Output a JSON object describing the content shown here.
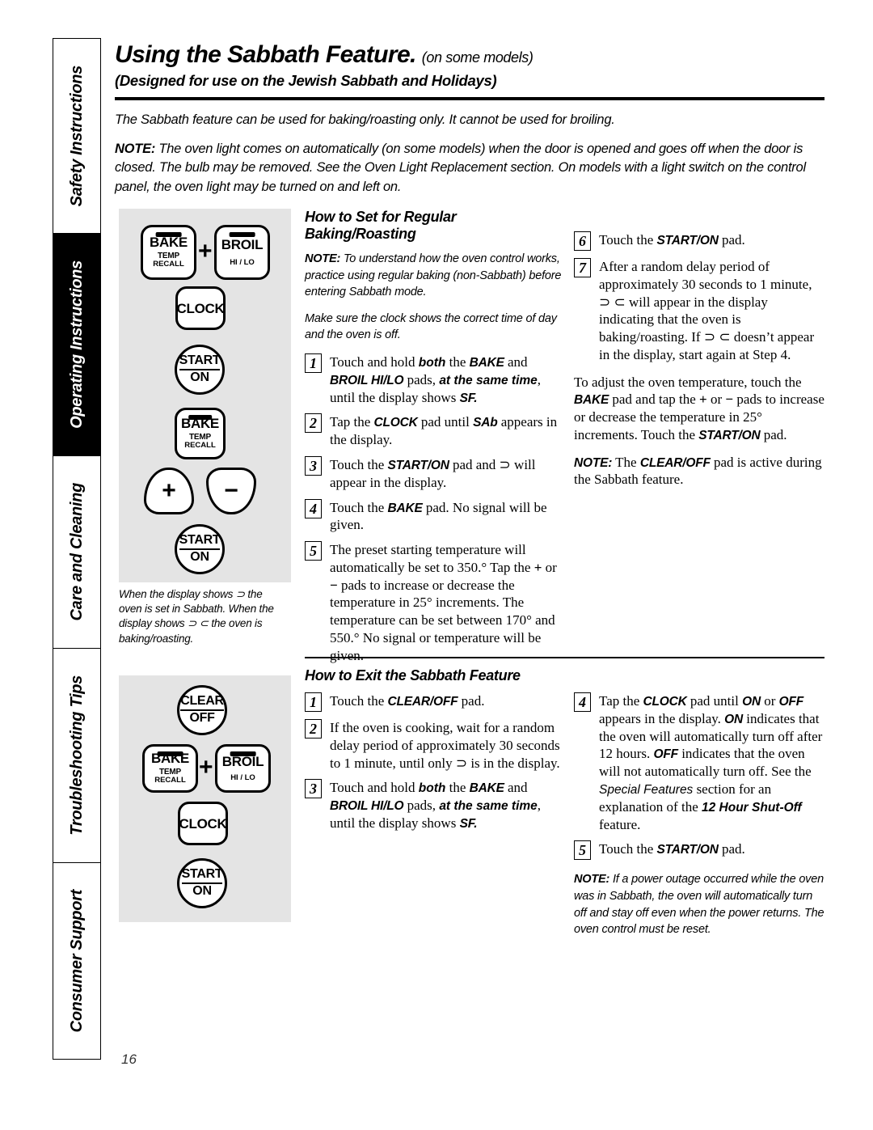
{
  "sidebar": {
    "tabs": [
      {
        "label": "Safety Instructions",
        "active": false
      },
      {
        "label": "Operating Instructions",
        "active": true
      },
      {
        "label": "Care and Cleaning",
        "active": false
      },
      {
        "label": "Troubleshooting Tips",
        "active": false
      },
      {
        "label": "Consumer Support",
        "active": false
      }
    ]
  },
  "header": {
    "title": "Using the Sabbath Feature.",
    "title_suffix": "(on some models)",
    "subtitle": "(Designed for use on the Jewish Sabbath and Holidays)",
    "intro": "The Sabbath feature can be used for baking/roasting only. It cannot be used for broiling.",
    "note_label": "NOTE:",
    "note_text": " The oven light comes on automatically (on some models) when the door is opened and goes off when the door is closed. The bulb may be removed. See the Oven Light Replacement section. On models with a light switch on the control panel, the oven light may be turned on and left on."
  },
  "set_section": {
    "heading": "How to Set for Regular Baking/Roasting",
    "note_label": "NOTE:",
    "note_text": " To understand how the oven control works, practice using regular baking (non-Sabbath) before entering Sabbath mode.",
    "note2": "Make sure the clock shows the correct time of day and the oven is off.",
    "steps": [
      {
        "num": "1",
        "text_html": "Touch and hold <i class=\"emb\">both</i> the <b class=\"pad\">BAKE</b> and <b class=\"pad\">BROIL HI/LO</b> pads, <i class=\"emb\">at the same time</i>, until the display shows <b class=\"pad\">SF.</b>"
      },
      {
        "num": "2",
        "text_html": "Tap the <b class=\"pad\">CLOCK</b> pad until <b class=\"pad\">SAb</b> appears in the display."
      },
      {
        "num": "3",
        "text_html": "Touch the <b class=\"pad\">START/ON</b> pad and &#8835; will appear in the display."
      },
      {
        "num": "4",
        "text_html": "Touch the <b class=\"pad\">BAKE</b> pad. No signal will be given."
      },
      {
        "num": "5",
        "text_html": "The preset starting temperature will automatically be set to 350.&deg; Tap the <b>+</b> or <b>&minus;</b> pads to increase or decrease the temperature in 25&deg; increments. The temperature can be set between 170&deg; and 550.&deg; No signal or temperature will be given."
      },
      {
        "num": "6",
        "text_html": "Touch the <b class=\"pad\">START/ON</b> pad."
      },
      {
        "num": "7",
        "text_html": "After a random delay period of approximately 30 seconds to 1 minute, &#8835; &#8834; will appear in the display indicating that the oven is baking/roasting. If &#8835; &#8834; doesn&rsquo;t appear in the display, start again at Step 4."
      }
    ],
    "adjust_html": "To adjust the oven temperature, touch the <b class=\"pad\">BAKE</b> pad and tap the <b>+</b> or <b>&minus;</b> pads to increase or decrease the temperature in 25&deg; increments. Touch the <b class=\"pad\">START/ON</b> pad.",
    "note3_html": "<b class=\"pad\">NOTE:</b> The <b class=\"pad\">CLEAR/OFF</b> pad is active during the Sabbath feature.",
    "caption": "When the display shows ⊃ the oven is set in Sabbath. When the display shows ⊃ ⊂ the oven is baking/roasting."
  },
  "exit_section": {
    "heading": "How to Exit the Sabbath Feature",
    "steps": [
      {
        "num": "1",
        "text_html": "Touch the <b class=\"pad\">CLEAR/OFF</b> pad."
      },
      {
        "num": "2",
        "text_html": "If the oven is cooking, wait for a random delay period of approximately 30 seconds to 1 minute, until only &#8835; is in the display."
      },
      {
        "num": "3",
        "text_html": "Touch and hold <i class=\"emb\">both</i> the <b class=\"pad\">BAKE</b> and <b class=\"pad\">BROIL HI/LO</b> pads, <i class=\"emb\">at the same time</i>, until the display shows <b class=\"pad\">SF.</b>"
      },
      {
        "num": "4",
        "text_html": "Tap the <b class=\"pad\">CLOCK</b> pad until <b class=\"pad\">ON</b> or <b class=\"pad\">OFF</b> appears in the display. <b class=\"pad\">ON</b> indicates that the oven will automatically turn off after 12 hours. <b class=\"pad\">OFF</b> indicates that the oven will not automatically turn off. See the <i class=\"em\">Special Features</i> section for an explanation of the <i class=\"emb\">12 Hour Shut-Off</i> feature."
      },
      {
        "num": "5",
        "text_html": "Touch the <b class=\"pad\">START/ON</b> pad."
      }
    ],
    "note_label": "NOTE:",
    "note_text": " If a power outage occurred while the oven was in Sabbath, the oven will automatically turn off and stay off even when the power returns. The oven control must be reset."
  },
  "diagram_top": {
    "buttons": [
      {
        "name": "bake",
        "main": "BAKE",
        "sub": "TEMP",
        "sub2": "RECALL"
      },
      {
        "name": "broil",
        "main": "BROIL",
        "sub2": "HI / LO"
      },
      {
        "name": "clock",
        "main": "CLOCK"
      },
      {
        "name": "start-on-1",
        "top": "START",
        "bot": "ON"
      },
      {
        "name": "bake-2",
        "main": "BAKE",
        "sub": "TEMP",
        "sub2": "RECALL"
      },
      {
        "name": "plus-pad",
        "glyph": "+"
      },
      {
        "name": "minus-pad",
        "glyph": "−"
      },
      {
        "name": "start-on-2",
        "top": "START",
        "bot": "ON"
      }
    ],
    "plus_connector": "+"
  },
  "diagram_bottom": {
    "buttons": [
      {
        "name": "clear-off",
        "top": "CLEAR",
        "bot": "OFF"
      },
      {
        "name": "bake",
        "main": "BAKE",
        "sub": "TEMP",
        "sub2": "RECALL"
      },
      {
        "name": "broil",
        "main": "BROIL",
        "sub2": "HI / LO"
      },
      {
        "name": "clock",
        "main": "CLOCK"
      },
      {
        "name": "start-on",
        "top": "START",
        "bot": "ON"
      }
    ],
    "plus_connector": "+"
  },
  "footer": {
    "page_number": "16"
  },
  "colors": {
    "panel_gray": "#e4e4e4",
    "ink": "#000000",
    "active_tab_bg": "#000000"
  }
}
